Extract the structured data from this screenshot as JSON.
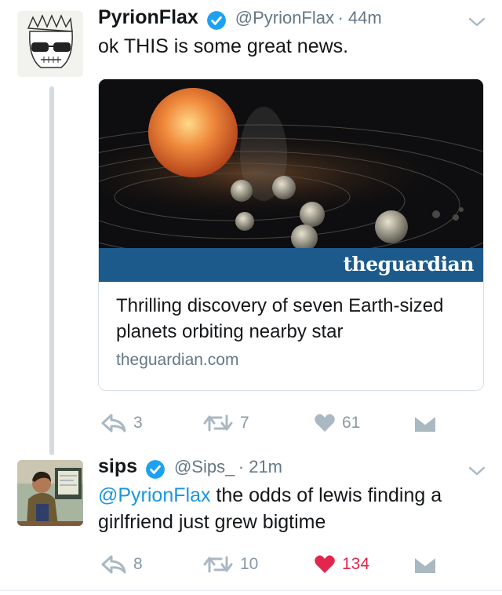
{
  "tweets": [
    {
      "name": "PyrionFlax",
      "handle": "@PyrionFlax",
      "time": "· 44m",
      "text": "ok THIS is some great news.",
      "card": {
        "source_logo": "theguardian",
        "title": "Thrilling discovery of seven Earth-sized planets orbiting nearby star",
        "domain": "theguardian.com"
      },
      "actions": {
        "replies": "3",
        "retweets": "7",
        "likes": "61"
      },
      "liked": false
    },
    {
      "name": "sips",
      "handle": "@Sips_",
      "time": "· 21m",
      "mention": "@PyrionFlax",
      "text": " the odds of lewis finding a girlfriend just grew bigtime",
      "actions": {
        "replies": "8",
        "retweets": "10",
        "likes": "134"
      },
      "liked": true
    }
  ],
  "icons": [
    "reply-icon",
    "retweet-icon",
    "heart-icon",
    "dm-icon",
    "chevron-down-icon",
    "verified-badge-icon"
  ],
  "colors": {
    "verified": "#1da1f2",
    "mention": "#1b95e0",
    "liked": "#e2264d",
    "icon_gray": "#aab8c2",
    "guardian_blue": "#1c5a8c"
  }
}
